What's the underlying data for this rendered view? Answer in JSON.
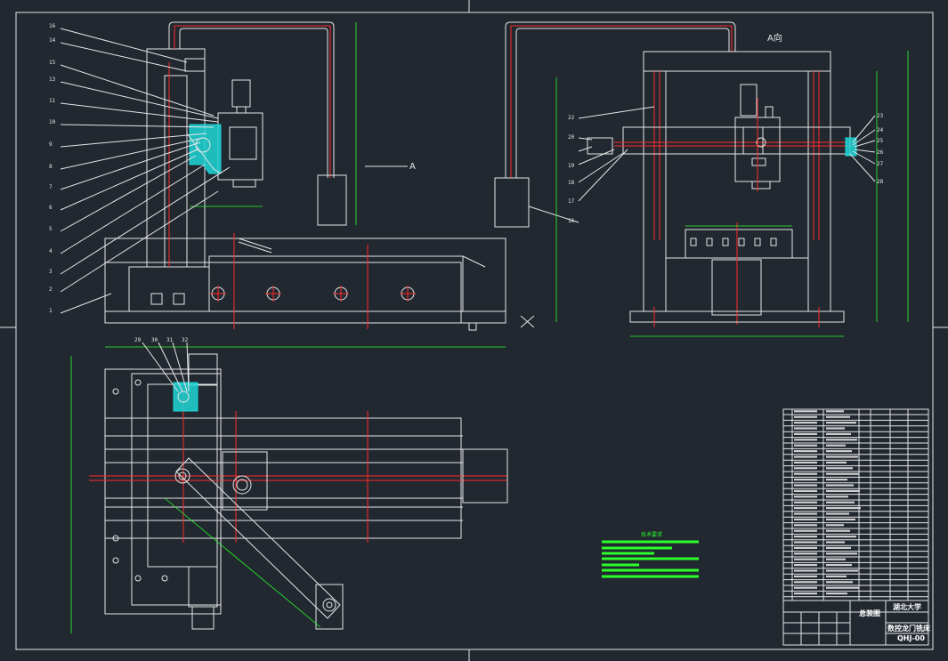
{
  "labels": {
    "front_view_callouts": [
      "16",
      "14",
      "15",
      "13",
      "11",
      "10",
      "9",
      "8",
      "7",
      "6",
      "5",
      "4",
      "3",
      "2",
      "1"
    ],
    "side_view_callouts_left": [
      "22",
      "20",
      "19",
      "18",
      "17"
    ],
    "side_view_callouts_right": [
      "23",
      "24",
      "25",
      "26",
      "27",
      "28"
    ],
    "side_view_callout_16": "16",
    "top_view_callouts": [
      "29",
      "30",
      "31",
      "32"
    ],
    "section_marker_a": "A",
    "view_a_label": "A向"
  },
  "title_block": {
    "school": "湖北大学",
    "drawing_title": "总装图",
    "subtitle": "数控龙门铣床",
    "drawing_number": "QHJ-00"
  },
  "tech_requirements_title": "技术要求",
  "colors": {
    "background": "#212830",
    "outline": "#e6e6e6",
    "centerline": "#ff2a2a",
    "dimension": "#2bff2b",
    "section_fill": "#1fd6d6"
  }
}
